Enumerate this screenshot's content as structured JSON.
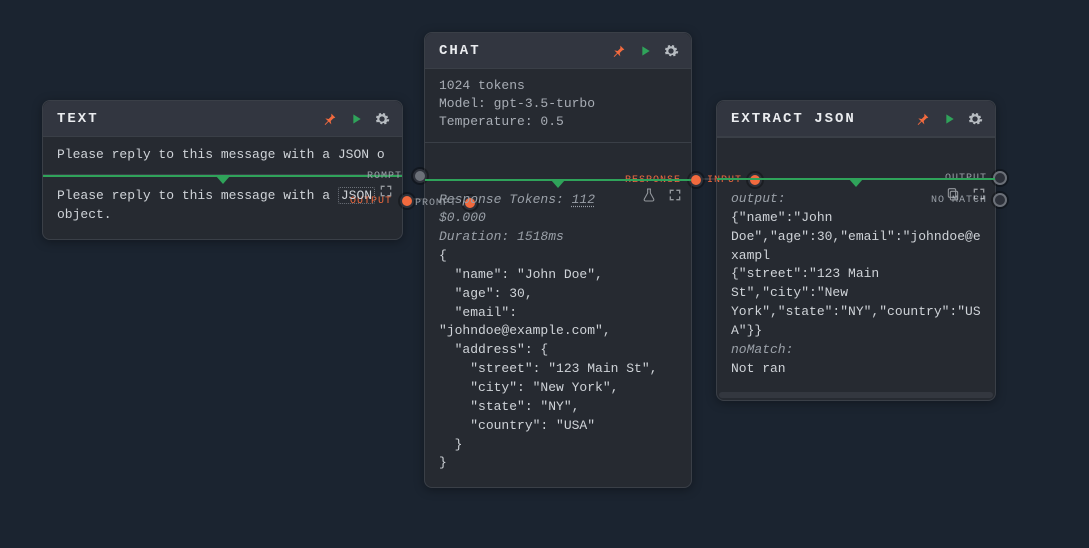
{
  "colors": {
    "accent_green": "#2fa35a",
    "accent_orange": "#f26a3e",
    "bg": "#1b2430"
  },
  "nodes": {
    "text": {
      "title": "TEXT",
      "input_preview": "Please reply to this message with a JSON o",
      "output_text_prefix": "Please reply to this message with a ",
      "output_text_boxed": "JSON",
      "output_text_suffix": " object.",
      "ports": {
        "output": "OUTPUT"
      }
    },
    "chat": {
      "title": "CHAT",
      "subheader": {
        "tokens": "1024 tokens",
        "model": "Model: gpt-3.5-turbo",
        "temperature": "Temperature: 0.5"
      },
      "meta": {
        "response_tokens_label": "Response Tokens: ",
        "response_tokens_value": "112",
        "cost": "$0.000",
        "duration": "Duration: 1518ms"
      },
      "body": "{\n  \"name\": \"John Doe\",\n  \"age\": 30,\n  \"email\": \"johndoe@example.com\",\n  \"address\": {\n    \"street\": \"123 Main St\",\n    \"city\": \"New York\",\n    \"state\": \"NY\",\n    \"country\": \"USA\"\n  }\n}",
      "ports": {
        "prompt_in": "PROMPT",
        "prompt_top": "ROMPT",
        "response": "RESPONSE"
      }
    },
    "extract": {
      "title": "EXTRACT JSON",
      "output_label": "output:",
      "output_body": "{\"name\":\"John Doe\",\"age\":30,\"email\":\"johndoe@exampl\n{\"street\":\"123 Main St\",\"city\":\"New York\",\"state\":\"NY\",\"country\":\"USA\"}}",
      "nomatch_label": "noMatch:",
      "nomatch_body": "Not ran",
      "ports": {
        "input": "INPUT",
        "output": "OUTPUT",
        "nomatch": "NO MATCH"
      }
    }
  }
}
